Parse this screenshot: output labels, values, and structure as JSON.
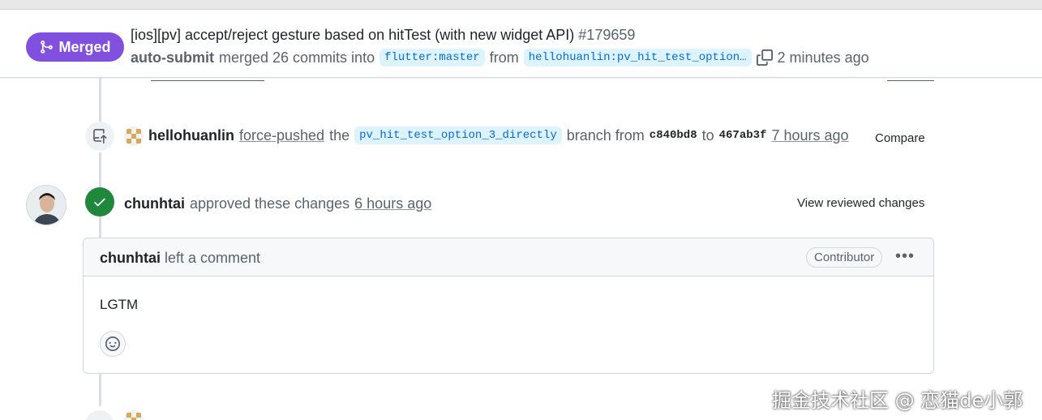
{
  "header": {
    "status_label": "Merged",
    "title": "[ios][pv] accept/reject gesture based on hitTest (with new widget API)",
    "number": "#179659",
    "merger": "auto-submit",
    "merged_text": "merged 26 commits into",
    "base_branch": "flutter:master",
    "from_text": "from",
    "head_branch": "hellohuanlin:pv_hit_test_option…",
    "time": "2 minutes ago"
  },
  "force_push": {
    "user": "hellohuanlin",
    "action": "force-pushed",
    "the_text": "the",
    "branch": "pv_hit_test_option_3_directly",
    "branch_from_text": "branch from",
    "from_sha": "c840bd8",
    "to_text": "to",
    "to_sha": "467ab3f",
    "time": "7 hours ago",
    "compare_label": "Compare"
  },
  "review": {
    "user": "chunhtai",
    "action": "approved these changes",
    "time": "6 hours ago",
    "view_label": "View reviewed changes"
  },
  "comment": {
    "author": "chunhtai",
    "action": "left a comment",
    "role": "Contributor",
    "more_label": "•••",
    "body": "LGTM"
  },
  "watermark": "掘金技术社区 @ 恋猫de小郭",
  "colors": {
    "merged": "#8250df",
    "approved": "#1f883d",
    "link": "#0969da",
    "branch_bg": "#ddf4ff"
  }
}
